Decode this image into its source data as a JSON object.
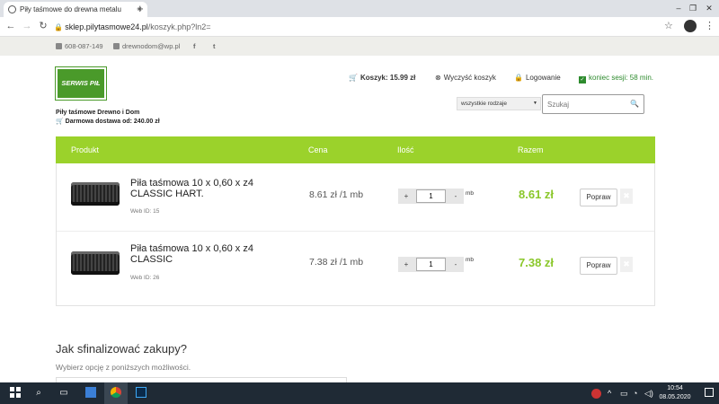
{
  "browser": {
    "tab_title": "Piły taśmowe do drewna metalu",
    "tab_close": "×",
    "new_tab": "+",
    "url_host": "sklep.pilytasmowe24.pl",
    "url_path": "/koszyk.php?ln2=",
    "window_buttons": [
      "–",
      "❐",
      "✕"
    ]
  },
  "infobar": {
    "phone": "608-087-149",
    "email": "drewnodom@wp.pl",
    "social": [
      "f",
      "t"
    ]
  },
  "header": {
    "logo_text": "SERWIS PIŁ",
    "store_name": "Piły taśmowe Drewno i Dom",
    "free_shipping": "Darmowa dostawa od: 240.00 zł",
    "cart_label": "Koszyk: 15.99 zł",
    "clear_cart": "Wyczyść koszyk",
    "login": "Logowanie",
    "session": "koniec sesji: 58 min.",
    "kind_select": "wszystkie rodzaje",
    "search_placeholder": "Szukaj"
  },
  "cart": {
    "columns": [
      "Produkt",
      "Cena",
      "Ilość",
      "Razem"
    ],
    "rows": [
      {
        "name": "Piła taśmowa 10 x 0,60 x z4 CLASSIC HART.",
        "web_id": "Web ID: 15",
        "price": "8.61 zł /1 mb",
        "qty": "1",
        "unit": "mb",
        "total": "8.61 zł",
        "fix_label": "Popraw",
        "minus": "-",
        "plus": "+",
        "delete": "✖"
      },
      {
        "name": "Piła taśmowa 10 x 0,60 x z4 CLASSIC",
        "web_id": "Web ID: 26",
        "price": "7.38 zł /1 mb",
        "qty": "1",
        "unit": "mb",
        "total": "7.38 zł",
        "fix_label": "Popraw",
        "minus": "-",
        "plus": "+",
        "delete": "✖"
      }
    ]
  },
  "finalize": {
    "title": "Jak sfinalizować zakupy?",
    "subtitle": "Wybierz opcję z poniższych możliwości."
  },
  "taskbar": {
    "time": "10:54",
    "date": "08.05.2020"
  },
  "colors": {
    "accent_green": "#9bd22b",
    "total_green": "#8ac72a",
    "session_green": "#2e8b2e"
  }
}
